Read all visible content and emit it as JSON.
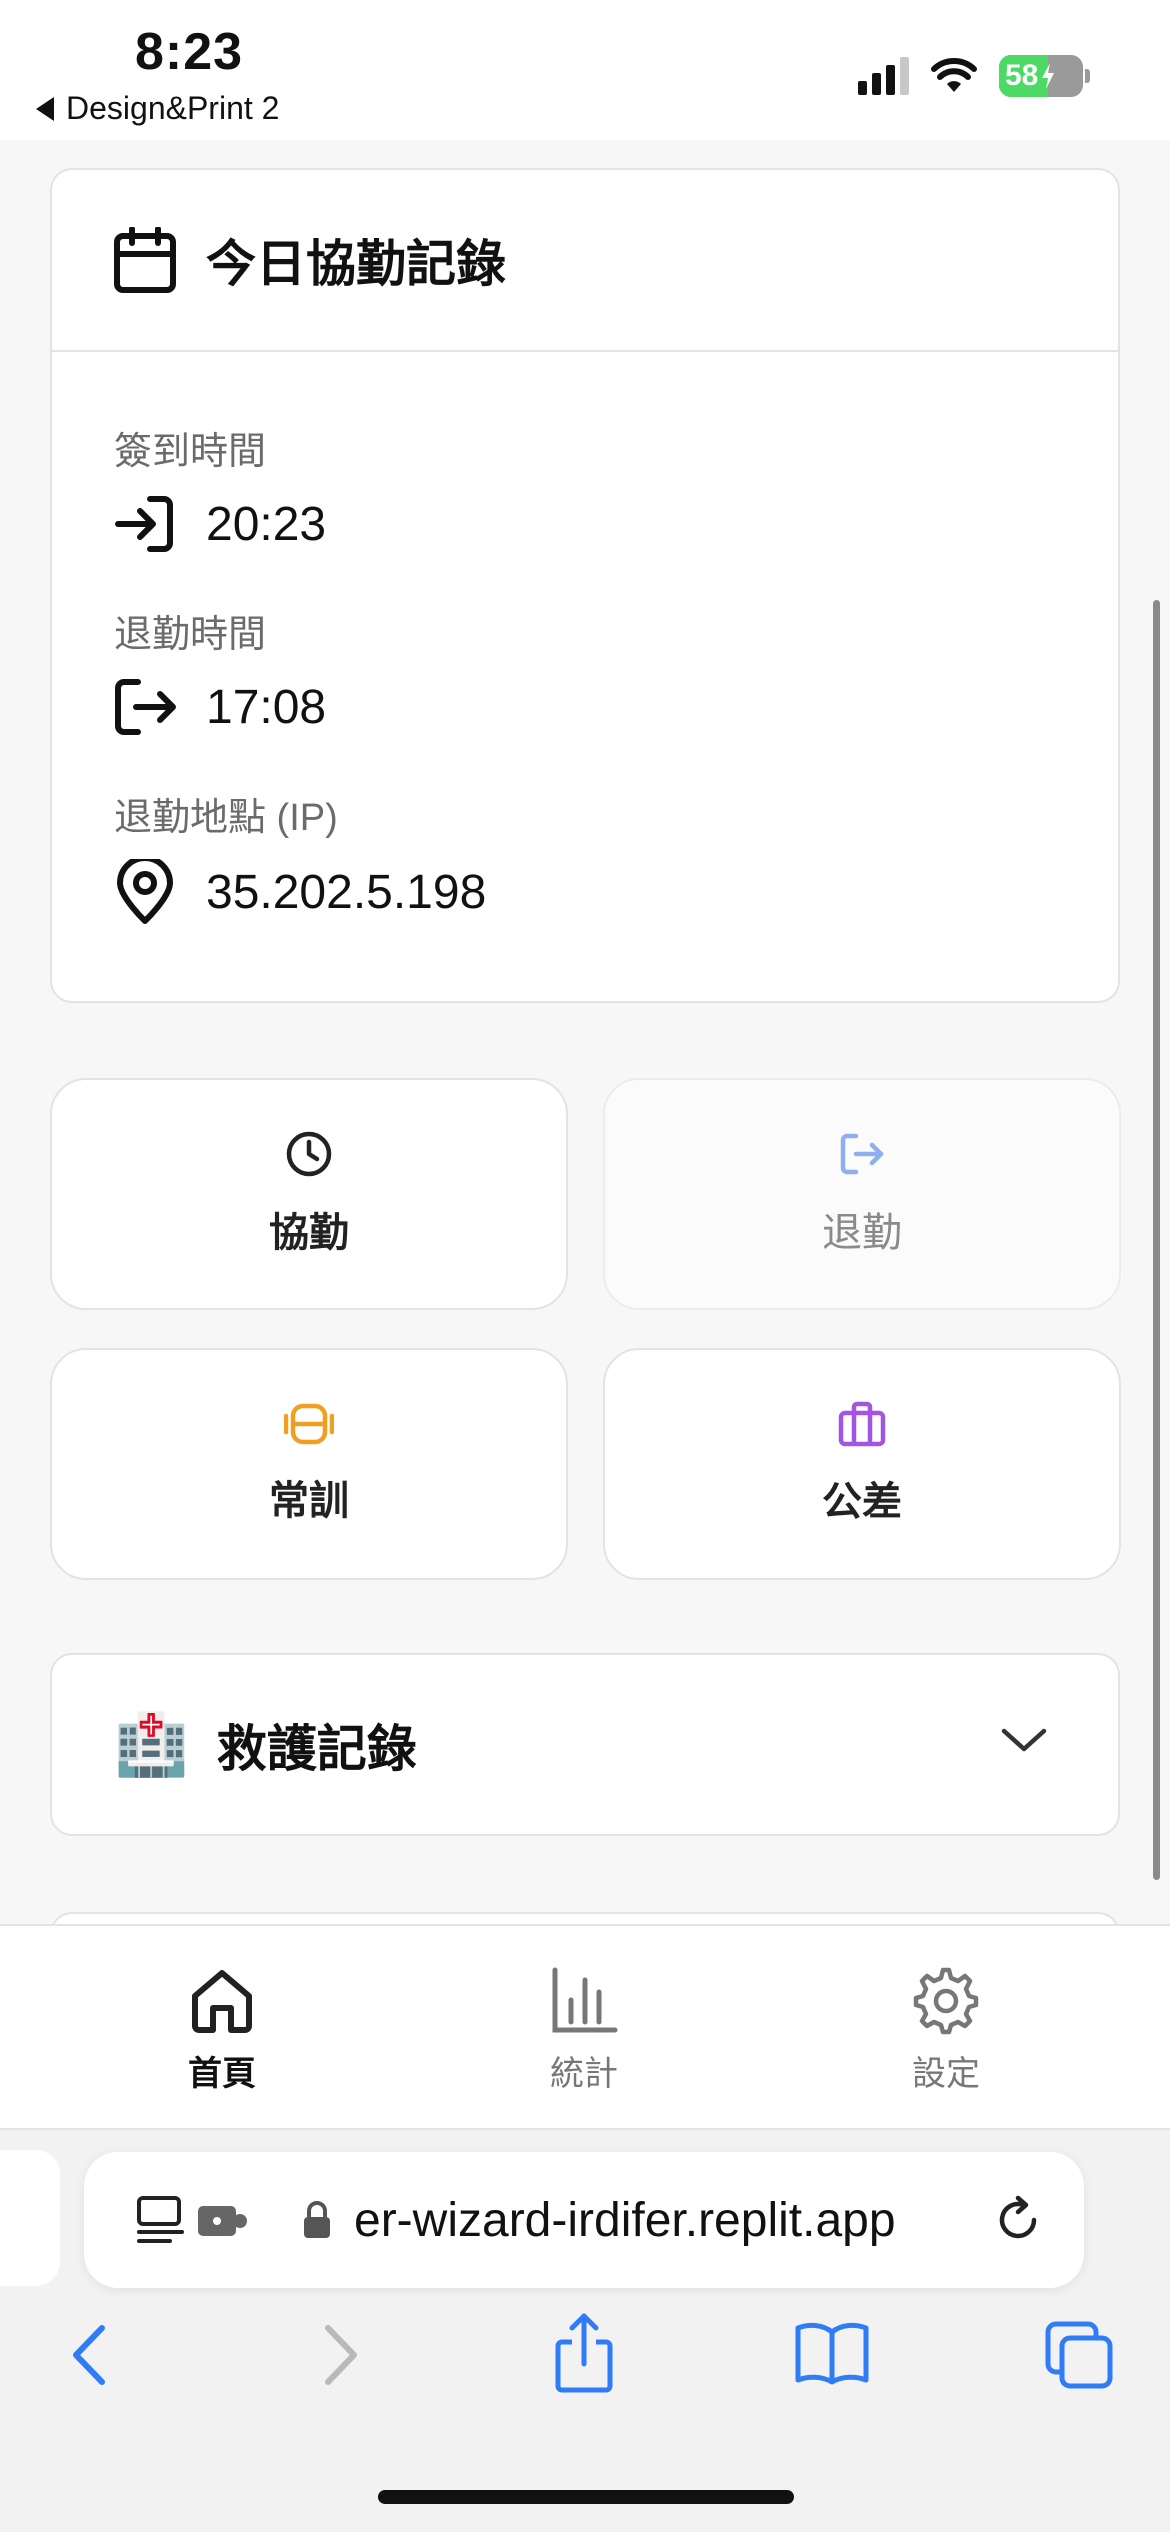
{
  "status_bar": {
    "time": "8:23",
    "back_label": "Design&Print 2",
    "battery": "58"
  },
  "record": {
    "title": "今日協勤記錄",
    "checkin_label": "簽到時間",
    "checkin_value": "20:23",
    "checkout_label": "退勤時間",
    "checkout_value": "17:08",
    "location_label": "退勤地點 (IP)",
    "location_value": "35.202.5.198"
  },
  "actions": [
    {
      "label": "協勤",
      "icon": "clock-icon",
      "color": "#222222"
    },
    {
      "label": "退勤",
      "icon": "logout-icon",
      "color": "#8fb0f0"
    },
    {
      "label": "常訓",
      "icon": "dumbbell-icon",
      "color": "#f0a020"
    },
    {
      "label": "公差",
      "icon": "briefcase-icon",
      "color": "#a255e0"
    }
  ],
  "rescue": {
    "emoji": "🏥",
    "title": "救護記錄"
  },
  "tabs": [
    {
      "label": "首頁",
      "icon": "home-icon"
    },
    {
      "label": "統計",
      "icon": "bar-chart-icon"
    },
    {
      "label": "設定",
      "icon": "gear-icon"
    }
  ],
  "browser": {
    "url": "er-wizard-irdifer.replit.app"
  }
}
